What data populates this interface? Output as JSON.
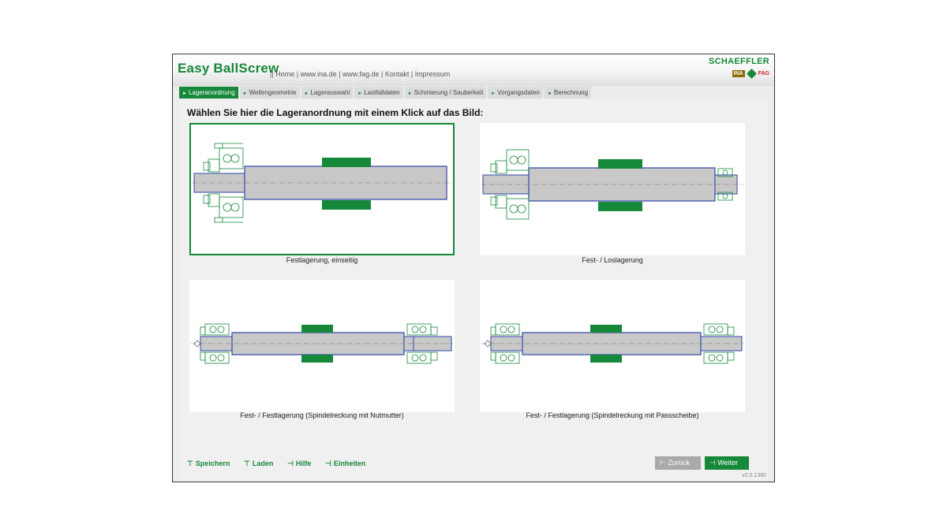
{
  "app": {
    "title": "Easy BallScrew",
    "links": {
      "sep_lead": "||",
      "home": "Home",
      "ina": "www.ina.de",
      "fag": "www.fag.de",
      "kontakt": "Kontakt",
      "impressum": "Impressum"
    },
    "brand": "SCHAEFFLER",
    "brand_ina": "INA",
    "brand_fag": "FAG",
    "accent_color": "#16883a"
  },
  "tabs": [
    {
      "label": "Lageranordnung",
      "active": true
    },
    {
      "label": "Wellengeometrie",
      "active": false
    },
    {
      "label": "Lagerauswahl",
      "active": false
    },
    {
      "label": "Lastfalldaten",
      "active": false
    },
    {
      "label": "Schmierung / Sauberkeit",
      "active": false
    },
    {
      "label": "Vorgangsdaten",
      "active": false
    },
    {
      "label": "Berechnung",
      "active": false
    }
  ],
  "main": {
    "prompt": "Wählen Sie hier die Lageranordnung mit einem Klick auf das Bild:",
    "options": [
      {
        "label": "Festlagerung, einseitig",
        "selected": true
      },
      {
        "label": "Fest- / Loslagerung",
        "selected": false
      },
      {
        "label": "Fest- / Festlagerung (Spindelreckung mit Nutmutter)",
        "selected": false
      },
      {
        "label": "Fest- / Festlagerung (Spindelreckung mit Passscheibe)",
        "selected": false
      }
    ]
  },
  "footer": {
    "save": "Speichern",
    "load": "Laden",
    "help": "Hilfe",
    "units": "Einheiten",
    "back": "Zurück",
    "next": "Weiter",
    "version": "v2.0.1380"
  }
}
